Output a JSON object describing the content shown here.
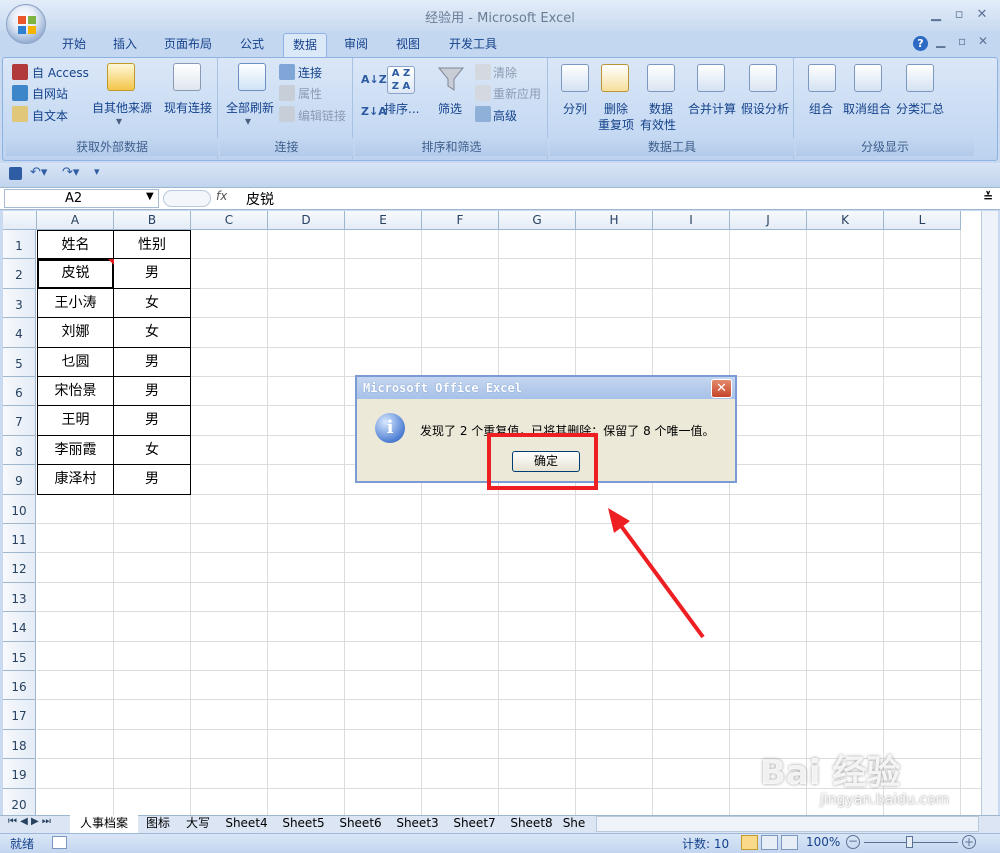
{
  "window": {
    "title": "经验用 - Microsoft Excel"
  },
  "tabs": [
    "开始",
    "插入",
    "页面布局",
    "公式",
    "数据",
    "审阅",
    "视图",
    "开发工具"
  ],
  "active_tab": "数据",
  "ribbon": {
    "get_external": {
      "access": "自 Access",
      "web": "自网站",
      "text": "自文本",
      "other": "自其他来源",
      "existing": "现有连接",
      "label": "获取外部数据"
    },
    "connections": {
      "refresh": "全部刷新",
      "conn": "连接",
      "props": "属性",
      "edit_links": "编辑链接",
      "label": "连接"
    },
    "sort_filter": {
      "sort": "排序...",
      "filter": "筛选",
      "clear": "清除",
      "reapply": "重新应用",
      "advanced": "高级",
      "label": "排序和筛选"
    },
    "data_tools": {
      "split": "分列",
      "remove_dup_1": "删除",
      "remove_dup_2": "重复项",
      "validation_1": "数据",
      "validation_2": "有效性",
      "consolidate": "合并计算",
      "whatif": "假设分析",
      "label": "数据工具"
    },
    "outline": {
      "group": "组合",
      "ungroup": "取消组合",
      "subtotal": "分类汇总",
      "label": "分级显示"
    }
  },
  "formula_bar": {
    "name_box": "A2",
    "fx": "fx",
    "content": "皮锐"
  },
  "columns": [
    "A",
    "B",
    "C",
    "D",
    "E",
    "F",
    "G",
    "H",
    "I",
    "J",
    "K",
    "L"
  ],
  "rows": [
    "1",
    "2",
    "3",
    "4",
    "5",
    "6",
    "7",
    "8",
    "9",
    "10",
    "11",
    "12",
    "13",
    "14",
    "15",
    "16",
    "17",
    "18",
    "19",
    "20"
  ],
  "table": [
    [
      "姓名",
      "性别"
    ],
    [
      "皮锐",
      "男"
    ],
    [
      "王小涛",
      "女"
    ],
    [
      "刘娜",
      "女"
    ],
    [
      "乜圆",
      "男"
    ],
    [
      "宋怡景",
      "男"
    ],
    [
      "王明",
      "男"
    ],
    [
      "李丽霞",
      "女"
    ],
    [
      "康泽村",
      "男"
    ]
  ],
  "sheets": [
    "人事档案",
    "图标",
    "大写",
    "Sheet4",
    "Sheet5",
    "Sheet6",
    "Sheet3",
    "Sheet7",
    "Sheet8",
    "She"
  ],
  "status": {
    "ready": "就绪",
    "count": "计数: 10",
    "zoom": "100%"
  },
  "dialog": {
    "title": "Microsoft Office Excel",
    "message": "发现了 2 个重复值，已将其删除；保留了 8 个唯一值。",
    "ok": "确定"
  },
  "watermark": {
    "main": "Bai 经验",
    "sub": "jingyan.baidu.com"
  }
}
